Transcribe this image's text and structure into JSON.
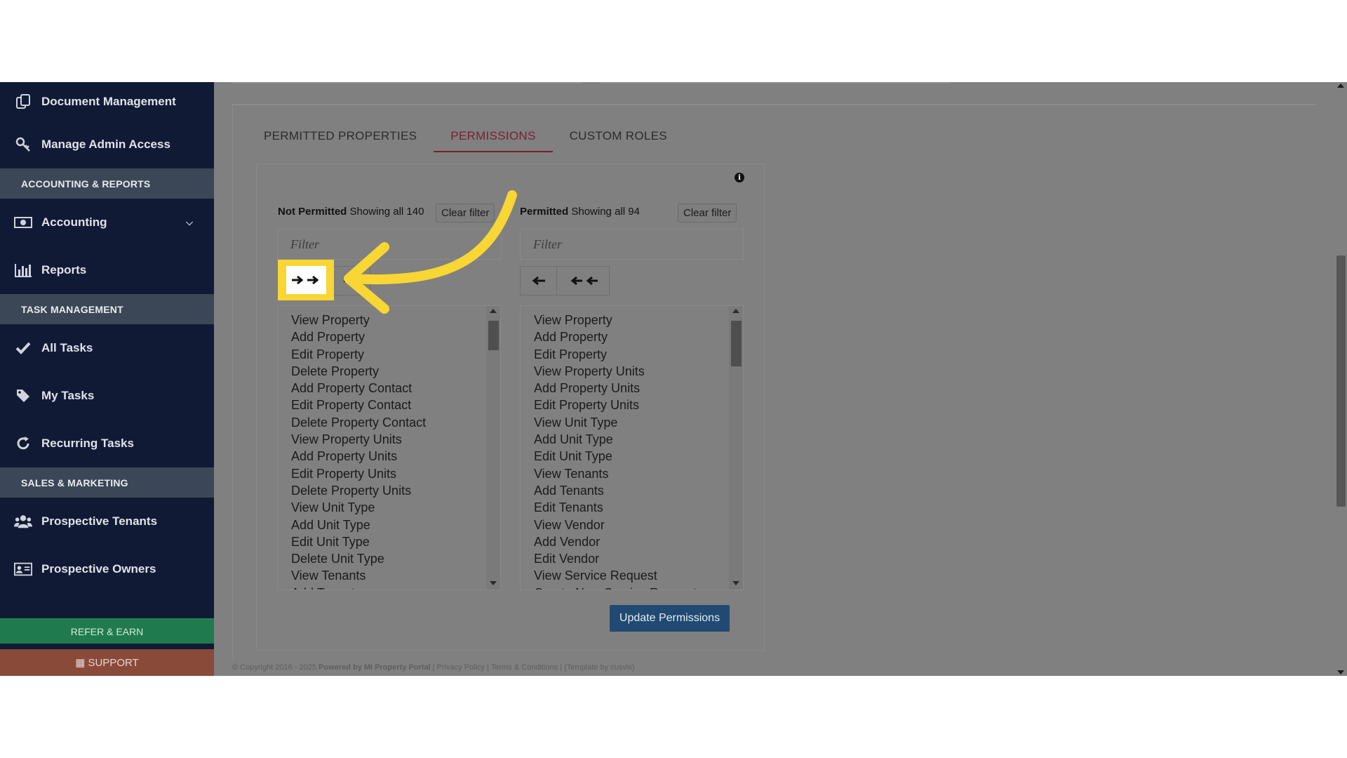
{
  "sidebar": {
    "items": [
      {
        "label": "Document Management",
        "icon": "documents-icon"
      },
      {
        "label": "Manage Admin Access",
        "icon": "key-icon"
      }
    ],
    "section_accounting": "ACCOUNTING & REPORTS",
    "accounting": {
      "label": "Accounting",
      "icon": "money-icon"
    },
    "reports": {
      "label": "Reports",
      "icon": "bar-chart-icon"
    },
    "section_tasks": "TASK MANAGEMENT",
    "all_tasks": {
      "label": "All Tasks",
      "icon": "check-icon"
    },
    "my_tasks": {
      "label": "My Tasks",
      "icon": "tag-icon"
    },
    "recurring_tasks": {
      "label": "Recurring Tasks",
      "icon": "refresh-icon"
    },
    "section_sales": "SALES & MARKETING",
    "prospective_tenants": {
      "label": "Prospective Tenants",
      "icon": "users-icon"
    },
    "prospective_owners": {
      "label": "Prospective Owners",
      "icon": "id-card-icon"
    },
    "refer": "REFER & EARN",
    "support": "SUPPORT"
  },
  "tabs": [
    "PERMITTED PROPERTIES",
    "PERMISSIONS",
    "CUSTOM ROLES"
  ],
  "active_tab": "PERMISSIONS",
  "not_permitted": {
    "title": "Not Permitted",
    "showing": "Showing all 140",
    "clear": "Clear filter",
    "filter_placeholder": "Filter",
    "items": [
      "View Property",
      "Add Property",
      "Edit Property",
      "Delete Property",
      "Add Property Contact",
      "Edit Property Contact",
      "Delete Property Contact",
      "View Property Units",
      "Add Property Units",
      "Edit Property Units",
      "Delete Property Units",
      "View Unit Type",
      "Add Unit Type",
      "Edit Unit Type",
      "Delete Unit Type",
      "View Tenants",
      "Add Tenants"
    ]
  },
  "permitted": {
    "title": "Permitted",
    "showing": "Showing all 94",
    "clear": "Clear filter",
    "filter_placeholder": "Filter",
    "items": [
      "View Property",
      "Add Property",
      "Edit Property",
      "View Property Units",
      "Add Property Units",
      "Edit Property Units",
      "View Unit Type",
      "Add Unit Type",
      "Edit Unit Type",
      "View Tenants",
      "Add Tenants",
      "Edit Tenants",
      "View Vendor",
      "Add Vendor",
      "Edit Vendor",
      "View Service Request",
      "Create New Service Request"
    ]
  },
  "update_button": "Update Permissions",
  "footer": {
    "copyright": "© Copyright 2016 - 2025",
    "powered": "Powered by MI Property Portal",
    "privacy": "Privacy Policy",
    "terms": "Terms & Conditions",
    "template": "(Template by cusvis)"
  },
  "colors": {
    "sidebar_bg": "#111a35",
    "highlight": "#f8d634",
    "active_tab": "#7a1d33",
    "update_button": "#204a72"
  }
}
